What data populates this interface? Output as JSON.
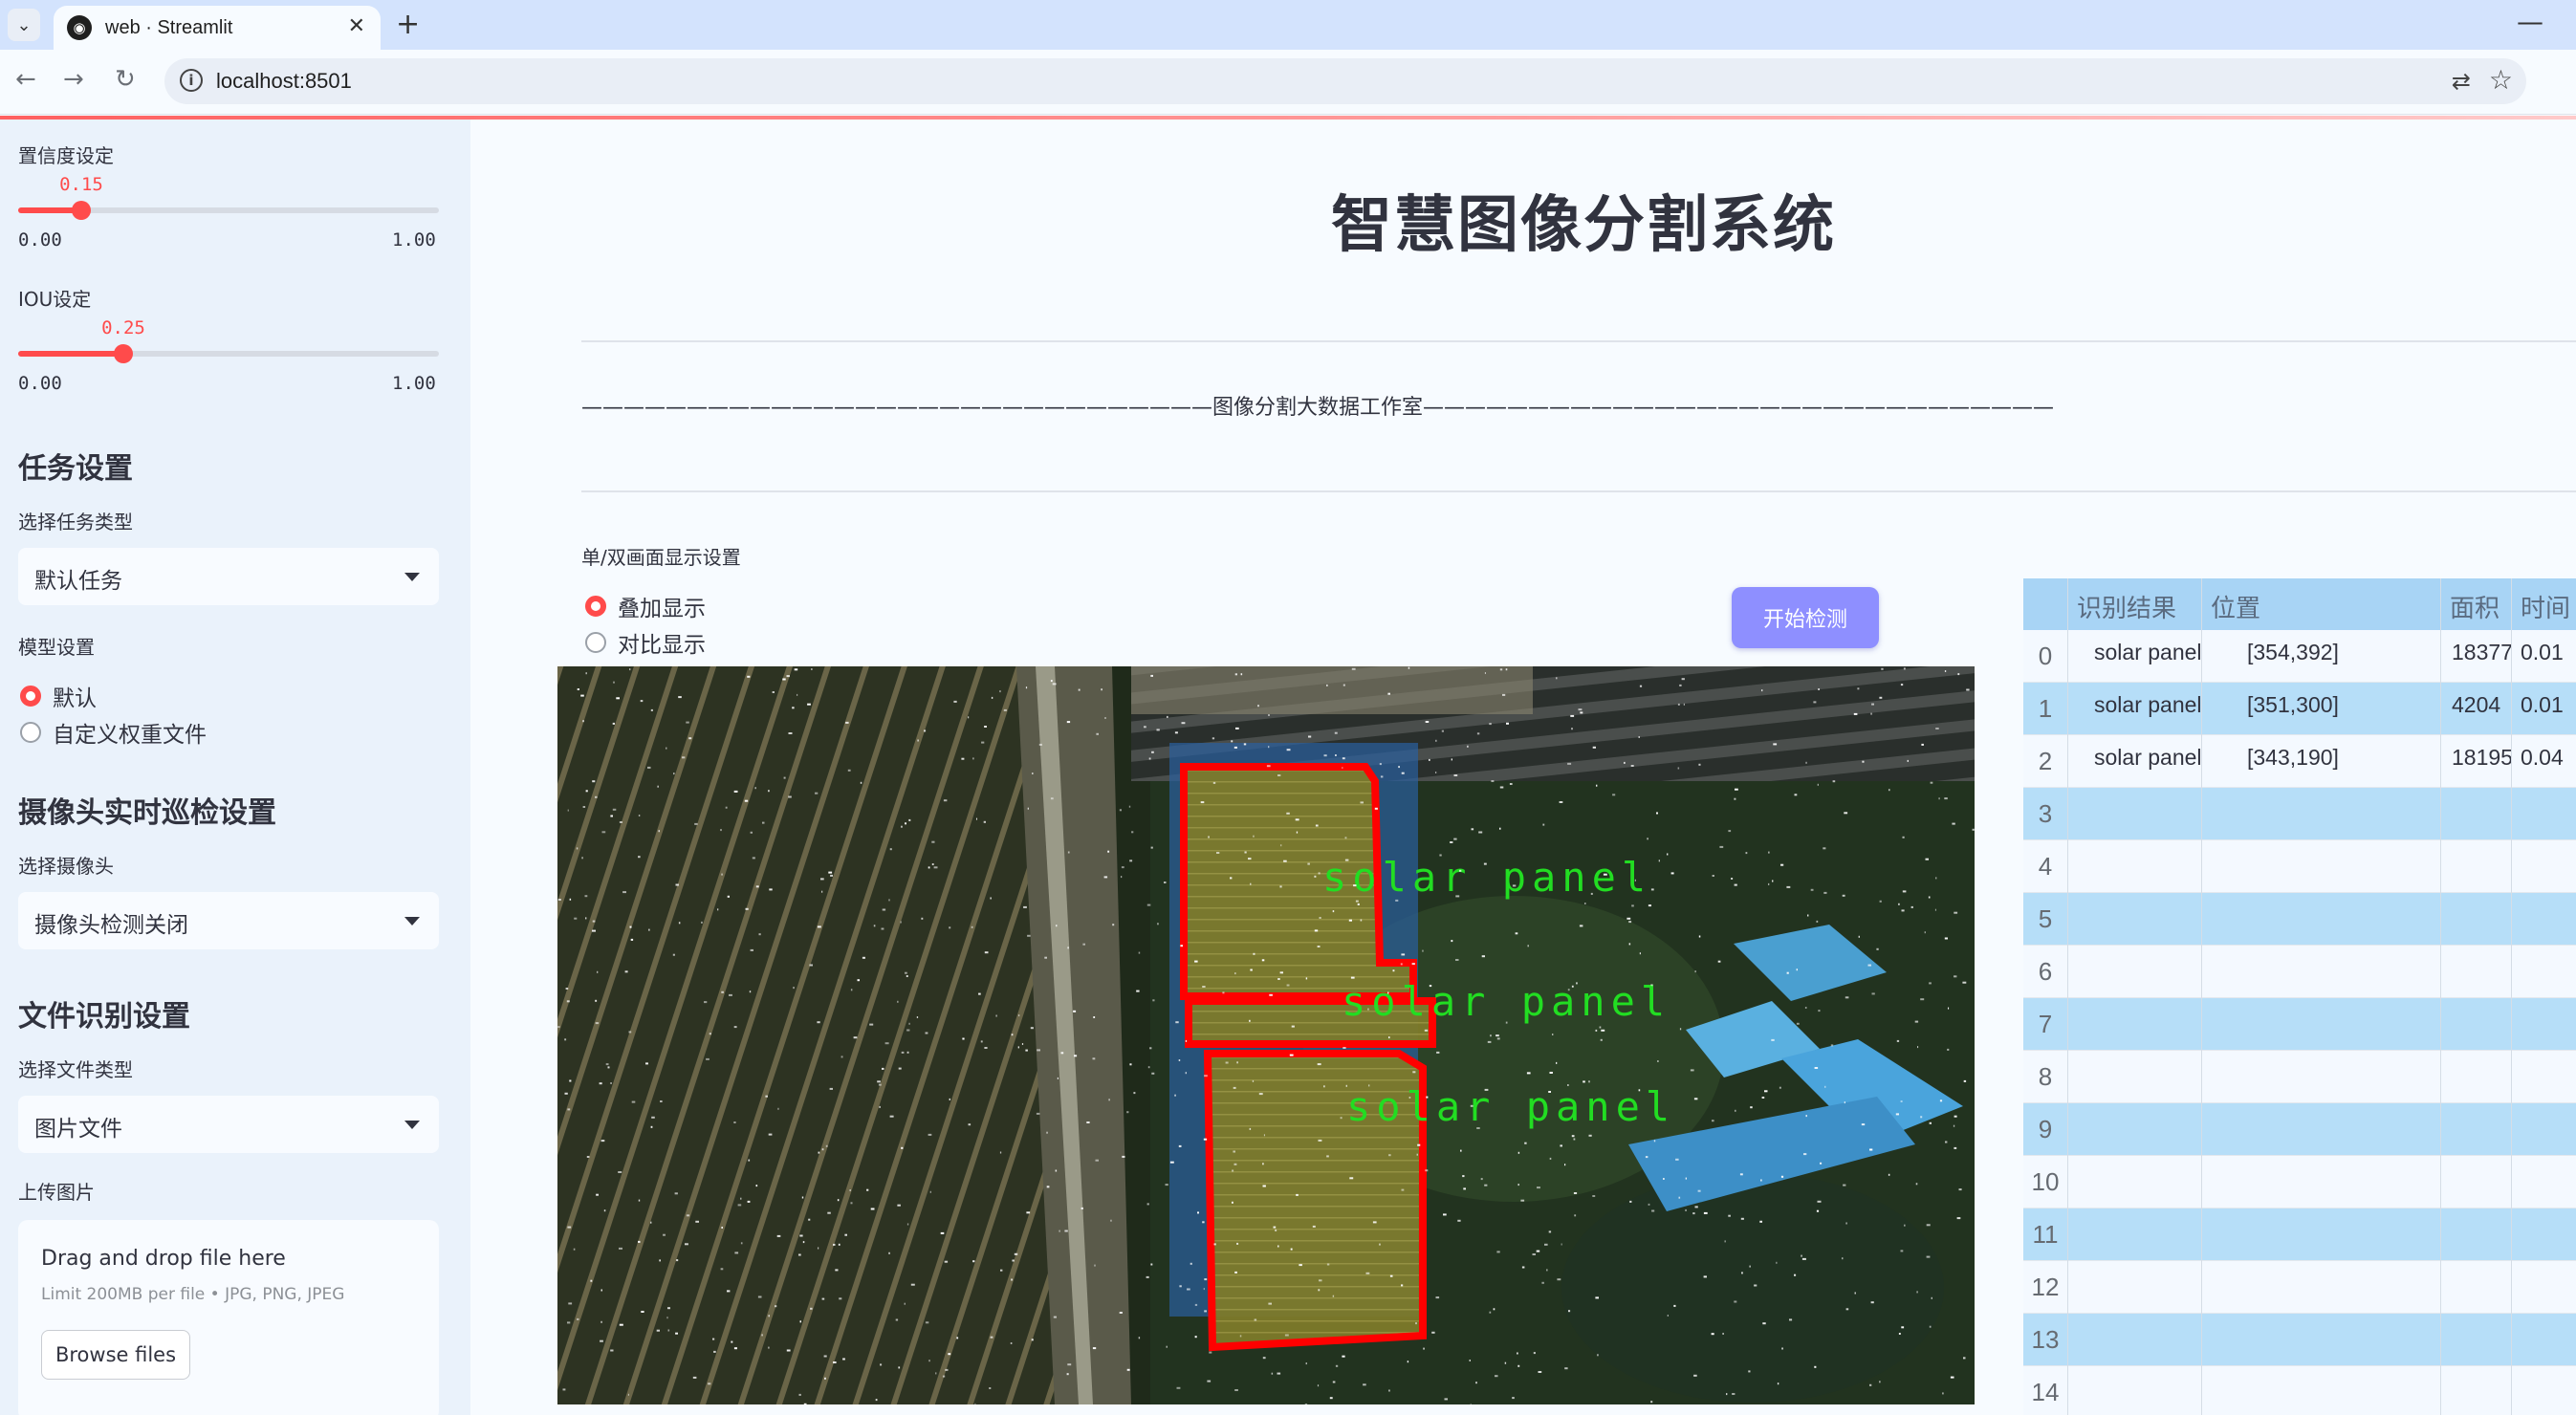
{
  "browser": {
    "tab_title": "web · Streamlit",
    "url": "localhost:8501"
  },
  "sidebar": {
    "confidence": {
      "label": "置信度设定",
      "value_text": "0.15",
      "value": 0.15,
      "min": "0.00",
      "max": "1.00"
    },
    "iou": {
      "label": "IOU设定",
      "value_text": "0.25",
      "value": 0.25,
      "min": "0.00",
      "max": "1.00"
    },
    "task_section": {
      "heading": "任务设置",
      "select_label": "选择任务类型",
      "selected": "默认任务"
    },
    "model_section": {
      "label": "模型设置",
      "options": [
        "默认",
        "自定义权重文件"
      ],
      "selected_index": 0
    },
    "camera_section": {
      "heading": "摄像头实时巡检设置",
      "select_label": "选择摄像头",
      "selected": "摄像头检测关闭"
    },
    "file_section": {
      "heading": "文件识别设置",
      "select_label": "选择文件类型",
      "selected": "图片文件"
    },
    "upload": {
      "label": "上传图片",
      "drop_text": "Drag and drop file here",
      "hint": "Limit 200MB per file • JPG, PNG, JPEG",
      "button": "Browse files"
    }
  },
  "main": {
    "title": "智慧图像分割系统",
    "banner": "——————————————————————————————图像分割大数据工作室——————————————————————————————",
    "display_mode": {
      "label": "单/双画面显示设置",
      "options": [
        "叠加显示",
        "对比显示"
      ],
      "selected_index": 0
    },
    "start_button": "开始检测",
    "detections": [
      {
        "label": "solar panel"
      },
      {
        "label": "solar panel"
      },
      {
        "label": "solar panel"
      }
    ]
  },
  "results_table": {
    "headers": [
      "识别结果",
      "位置",
      "面积",
      "时间"
    ],
    "rows": [
      {
        "index": "0",
        "result": "solar panel",
        "position": "[354,392]",
        "area": "18377",
        "time": "0.01"
      },
      {
        "index": "1",
        "result": "solar panel",
        "position": "[351,300]",
        "area": "4204",
        "time": "0.01"
      },
      {
        "index": "2",
        "result": "solar panel",
        "position": "[343,190]",
        "area": "18195",
        "time": "0.04"
      },
      {
        "index": "3",
        "result": "",
        "position": "",
        "area": "",
        "time": ""
      },
      {
        "index": "4",
        "result": "",
        "position": "",
        "area": "",
        "time": ""
      },
      {
        "index": "5",
        "result": "",
        "position": "",
        "area": "",
        "time": ""
      },
      {
        "index": "6",
        "result": "",
        "position": "",
        "area": "",
        "time": ""
      },
      {
        "index": "7",
        "result": "",
        "position": "",
        "area": "",
        "time": ""
      },
      {
        "index": "8",
        "result": "",
        "position": "",
        "area": "",
        "time": ""
      },
      {
        "index": "9",
        "result": "",
        "position": "",
        "area": "",
        "time": ""
      },
      {
        "index": "10",
        "result": "",
        "position": "",
        "area": "",
        "time": ""
      },
      {
        "index": "11",
        "result": "",
        "position": "",
        "area": "",
        "time": ""
      },
      {
        "index": "12",
        "result": "",
        "position": "",
        "area": "",
        "time": ""
      },
      {
        "index": "13",
        "result": "",
        "position": "",
        "area": "",
        "time": ""
      },
      {
        "index": "14",
        "result": "",
        "position": "",
        "area": "",
        "time": ""
      }
    ]
  },
  "colors": {
    "accent": "#ff4b4b",
    "button": "#8e8fff",
    "table_stripe": "#b6def8",
    "mask_outline": "#ff0000",
    "mask_fill": "#8a8a20",
    "label_text": "#22dd22"
  }
}
